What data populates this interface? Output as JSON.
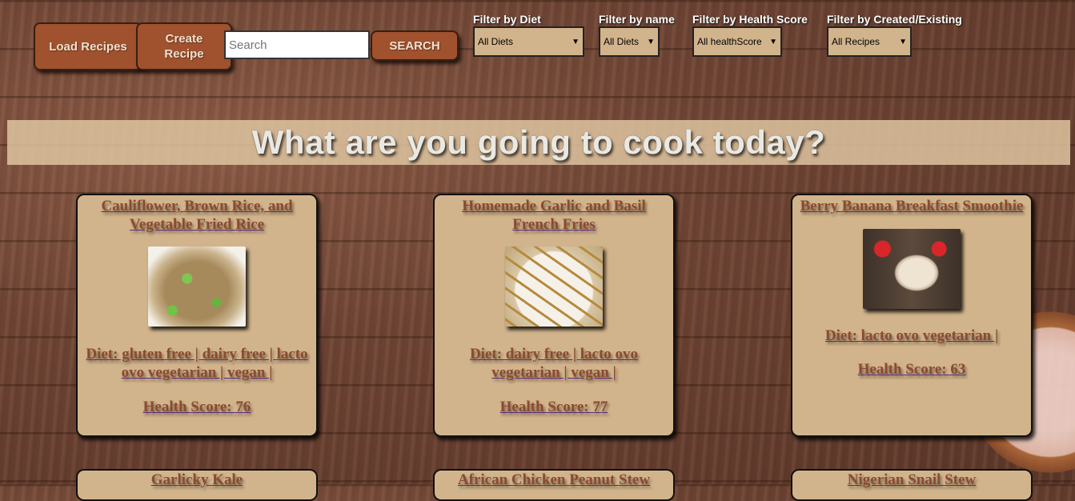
{
  "toolbar": {
    "load_label": "Load Recipes",
    "create_label": "Create Recipe",
    "search_placeholder": "Search",
    "search_label": "SEARCH"
  },
  "filters": [
    {
      "label": "Filter by Diet",
      "value": "All Diets"
    },
    {
      "label": "Filter by name",
      "value": "All Diets"
    },
    {
      "label": "Filter by Health Score",
      "value": "All healthScore"
    },
    {
      "label": "Filter by Created/Existing",
      "value": "All Recipes"
    }
  ],
  "hero": {
    "title": "What are you going to cook today?"
  },
  "recipes": [
    {
      "title": "Cauliflower, Brown Rice, and Vegetable Fried Rice",
      "diet": "Diet: gluten free | dairy free | lacto ovo vegetarian | vegan |",
      "score": "Health Score: 76"
    },
    {
      "title": "Homemade Garlic and Basil French Fries",
      "diet": "Diet: dairy free | lacto ovo vegetarian | vegan |",
      "score": "Health Score: 77"
    },
    {
      "title": "Berry Banana Breakfast Smoothie",
      "diet": "Diet: lacto ovo vegetarian |",
      "score": "Health Score: 63"
    },
    {
      "title": "Garlicky Kale"
    },
    {
      "title": "African Chicken Peanut Stew"
    },
    {
      "title": "Nigerian Snail Stew"
    }
  ],
  "colors": {
    "accent": "#a0512d",
    "card": "#d2b48c",
    "link": "#8b4a30"
  }
}
